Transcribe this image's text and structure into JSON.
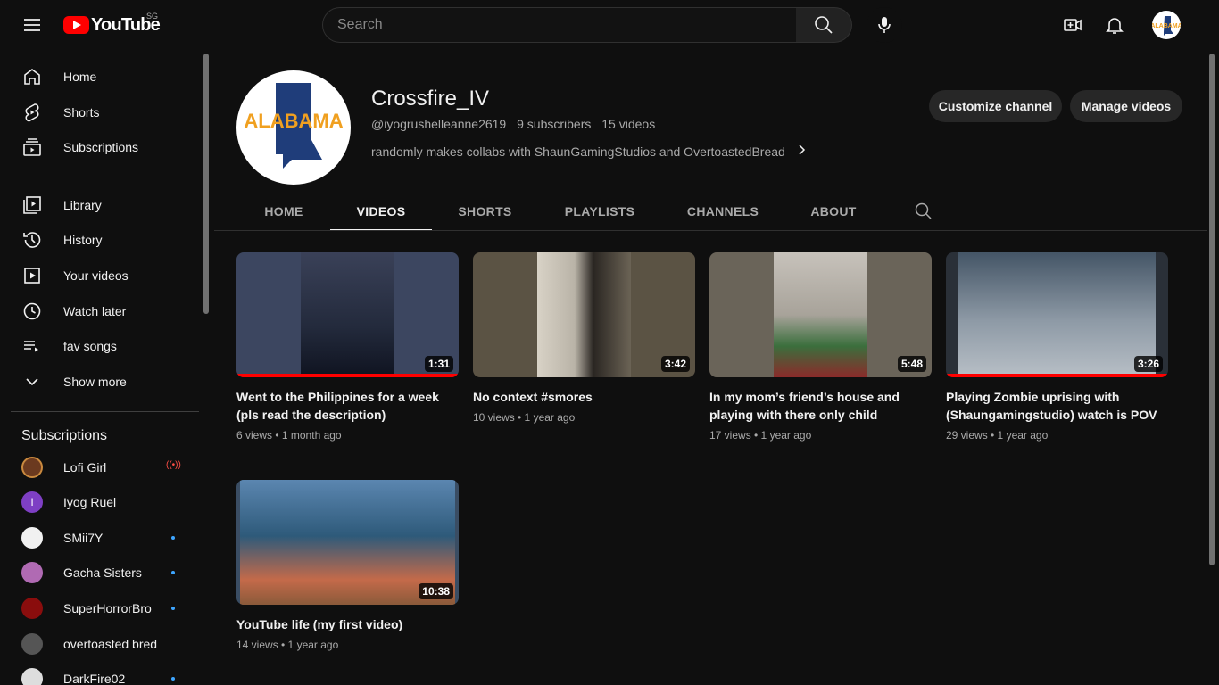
{
  "header": {
    "logo_text": "YouTube",
    "region": "SG",
    "search_placeholder": "Search",
    "menu_icon": "hamburger-icon",
    "search_icon": "search-icon",
    "mic_icon": "mic-icon",
    "create_icon": "video-create-icon",
    "bell_icon": "bell-icon"
  },
  "sidebar": {
    "main_items": [
      {
        "label": "Home",
        "icon": "home-icon"
      },
      {
        "label": "Shorts",
        "icon": "shorts-icon"
      },
      {
        "label": "Subscriptions",
        "icon": "subscriptions-icon"
      }
    ],
    "library_items": [
      {
        "label": "Library",
        "icon": "library-icon"
      },
      {
        "label": "History",
        "icon": "history-icon"
      },
      {
        "label": "Your videos",
        "icon": "your-videos-icon"
      },
      {
        "label": "Watch later",
        "icon": "clock-icon"
      },
      {
        "label": "fav songs",
        "icon": "playlist-icon"
      },
      {
        "label": "Show more",
        "icon": "chevron-down-icon"
      }
    ],
    "subscriptions_heading": "Subscriptions",
    "subscriptions": [
      {
        "name": "Lofi Girl",
        "status": "live",
        "color": "#6b3a1f",
        "initial": ""
      },
      {
        "name": "Iyog Ruel",
        "status": "none",
        "color": "#7e3fc4",
        "initial": "I"
      },
      {
        "name": "SMii7Y",
        "status": "new",
        "color": "#f1f1f1",
        "initial": ""
      },
      {
        "name": "Gacha Sisters",
        "status": "new",
        "color": "#b06ab3",
        "initial": ""
      },
      {
        "name": "SuperHorrorBro",
        "status": "new",
        "color": "#8a0d0d",
        "initial": ""
      },
      {
        "name": "overtoasted bred",
        "status": "none",
        "color": "#555555",
        "initial": ""
      },
      {
        "name": "DarkFire02",
        "status": "new",
        "color": "#dddddd",
        "initial": ""
      }
    ]
  },
  "channel": {
    "name": "Crossfire_IV",
    "handle": "@iyogrushelleanne2619",
    "subscribers": "9 subscribers",
    "videos_count": "15 videos",
    "description": "randomly makes collabs with ShaunGamingStudios and OvertoastedBread",
    "avatar_text": "ALABAMA",
    "customize_label": "Customize channel",
    "manage_label": "Manage videos"
  },
  "tabs": [
    {
      "label": "HOME",
      "active": false
    },
    {
      "label": "VIDEOS",
      "active": true
    },
    {
      "label": "SHORTS",
      "active": false
    },
    {
      "label": "PLAYLISTS",
      "active": false
    },
    {
      "label": "CHANNELS",
      "active": false
    },
    {
      "label": "ABOUT",
      "active": false
    }
  ],
  "videos": [
    {
      "title": "Went to the Philippines for a week (pls read the description)",
      "meta": "6 views • 1 month ago",
      "duration": "1:31",
      "watched": 1.0,
      "bg": "#3c4660",
      "inner": "#232a3c"
    },
    {
      "title": "No context #smores",
      "meta": "10 views • 1 year ago",
      "duration": "3:42",
      "watched": 0,
      "bg": "#5b5344",
      "inner": "#d8d2c6"
    },
    {
      "title": "In my mom’s friend’s house and playing with there only child",
      "meta": "17 views • 1 year ago",
      "duration": "5:48",
      "watched": 0,
      "bg": "#6a6459",
      "inner": "#c7c2bb"
    },
    {
      "title": "Playing Zombie uprising with (Shaungamingstudio) watch is POV of Shaungamingstudio",
      "meta": "29 views • 1 year ago",
      "duration": "3:26",
      "watched": 1.0,
      "bg": "#2a3038",
      "inner": "#8e9aa6"
    },
    {
      "title": "YouTube life (my first video)",
      "meta": "14 views • 1 year ago",
      "duration": "10:38",
      "watched": 0,
      "bg": "#3a4d63",
      "inner": "#5b86b0"
    }
  ]
}
